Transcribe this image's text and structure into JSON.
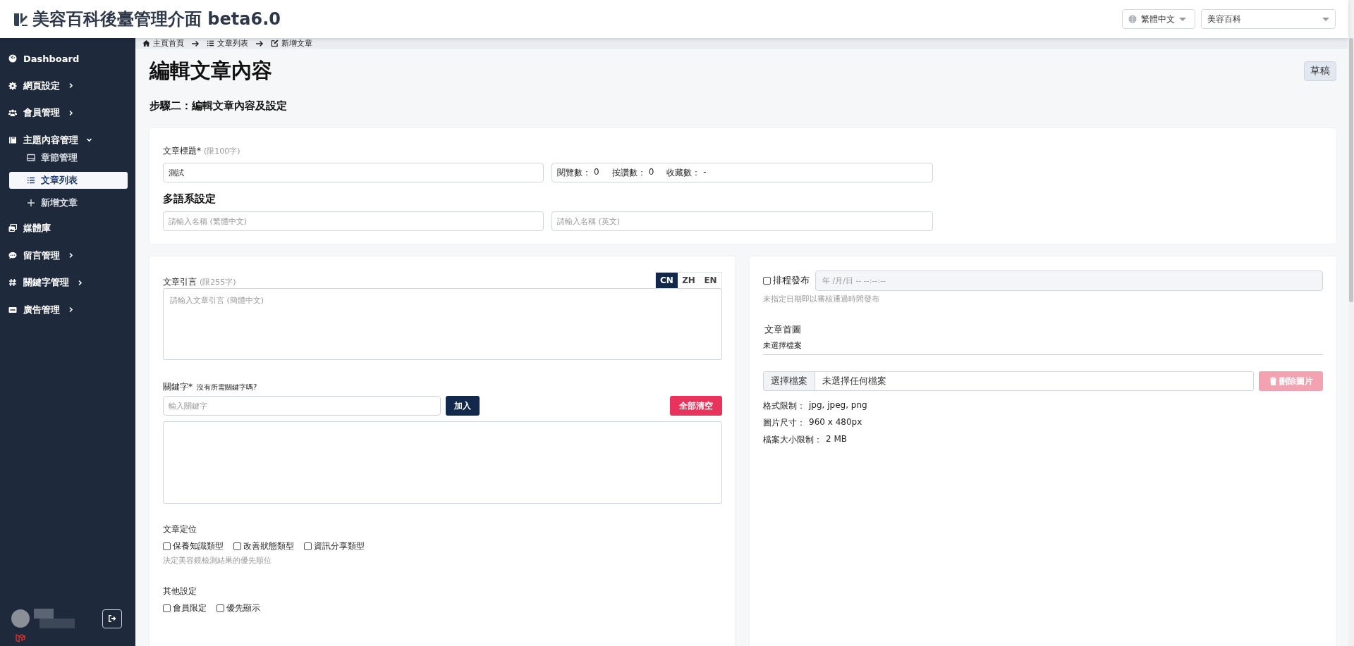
{
  "header": {
    "title": "美容百科後臺管理介面 beta6.0",
    "language_select": {
      "value": "繁體中文"
    },
    "site_select": {
      "value": "美容百科"
    }
  },
  "sidebar": {
    "items": [
      {
        "label": "Dashboard",
        "selected": false
      },
      {
        "label": "網頁設定",
        "selected": false,
        "expanded": false
      },
      {
        "label": "會員管理",
        "selected": false,
        "expanded": false
      },
      {
        "label": "主題內容管理",
        "selected": false,
        "expanded": true,
        "children": [
          {
            "label": "章節管理",
            "selected": false
          },
          {
            "label": "文章列表",
            "selected": true
          },
          {
            "label": "新增文章",
            "selected": false
          }
        ]
      },
      {
        "label": "媒體庫",
        "selected": false
      },
      {
        "label": "留言管理",
        "selected": false,
        "expanded": false
      },
      {
        "label": "關鍵字管理",
        "selected": false,
        "expanded": false
      },
      {
        "label": "廣告管理",
        "selected": false,
        "expanded": false
      }
    ]
  },
  "breadcrumb": [
    {
      "label": "主頁首頁"
    },
    {
      "label": "文章列表"
    },
    {
      "label": "新增文章"
    }
  ],
  "page": {
    "title": "編輯文章內容",
    "status_badge": "草稿",
    "step_title": "步驟二：編輯文章內容及設定"
  },
  "basic_card": {
    "title_field": {
      "label": "文章標題*",
      "note": "(限100字)",
      "value": "測試"
    },
    "stats": [
      {
        "label": "閱覽數：",
        "value": "0"
      },
      {
        "label": "按讚數：",
        "value": "0"
      },
      {
        "label": "收藏數：",
        "value": "-"
      }
    ],
    "multilang": {
      "heading": "多語系設定",
      "fields": [
        {
          "placeholder": "請輸入名稱 (繁體中文)"
        },
        {
          "placeholder": "請輸入名稱 (英文)"
        }
      ]
    }
  },
  "excerpt": {
    "label": "文章引言",
    "note": "(限255字)",
    "lang_tabs": [
      {
        "label": "CN",
        "selected": true
      },
      {
        "label": "ZH",
        "selected": false
      },
      {
        "label": "EN",
        "selected": false
      }
    ],
    "placeholder": "請輸入文章引言 (簡體中文)"
  },
  "keywords": {
    "label": "關鍵字*",
    "help_link": "沒有所需關鍵字嗎?",
    "placeholder": "輸入關鍵字",
    "add_button": "加入",
    "clear_button": "全部清空"
  },
  "positioning": {
    "label": "文章定位",
    "options": [
      {
        "label": "保養知識類型",
        "checked": false
      },
      {
        "label": "改善狀態類型",
        "checked": false
      },
      {
        "label": "資訊分享類型",
        "checked": false
      }
    ],
    "hint": "決定美容鏡檢測結果的優先順位"
  },
  "other_settings": {
    "label": "其他設定",
    "options": [
      {
        "label": "會員限定",
        "checked": false
      },
      {
        "label": "優先顯示",
        "checked": false
      }
    ]
  },
  "schedule": {
    "label": "排程發布",
    "checked": false,
    "placeholder": "年 /月/日 -- --:--:--",
    "hint": "未指定日期即以審核通過時間發布"
  },
  "cover": {
    "label": "文章首圖",
    "file_status": "未選擇檔案",
    "choose_button": "選擇檔案",
    "file_name": "未選擇任何檔案",
    "delete_button": {
      "label": "刪除圖片",
      "disabled": true
    },
    "info": [
      {
        "label": "格式限制：",
        "value": "jpg, jpeg, png"
      },
      {
        "label": "圖片尺寸：",
        "value": "960 x 480px"
      },
      {
        "label": "檔案大小限制：",
        "value": "2 MB"
      }
    ]
  }
}
